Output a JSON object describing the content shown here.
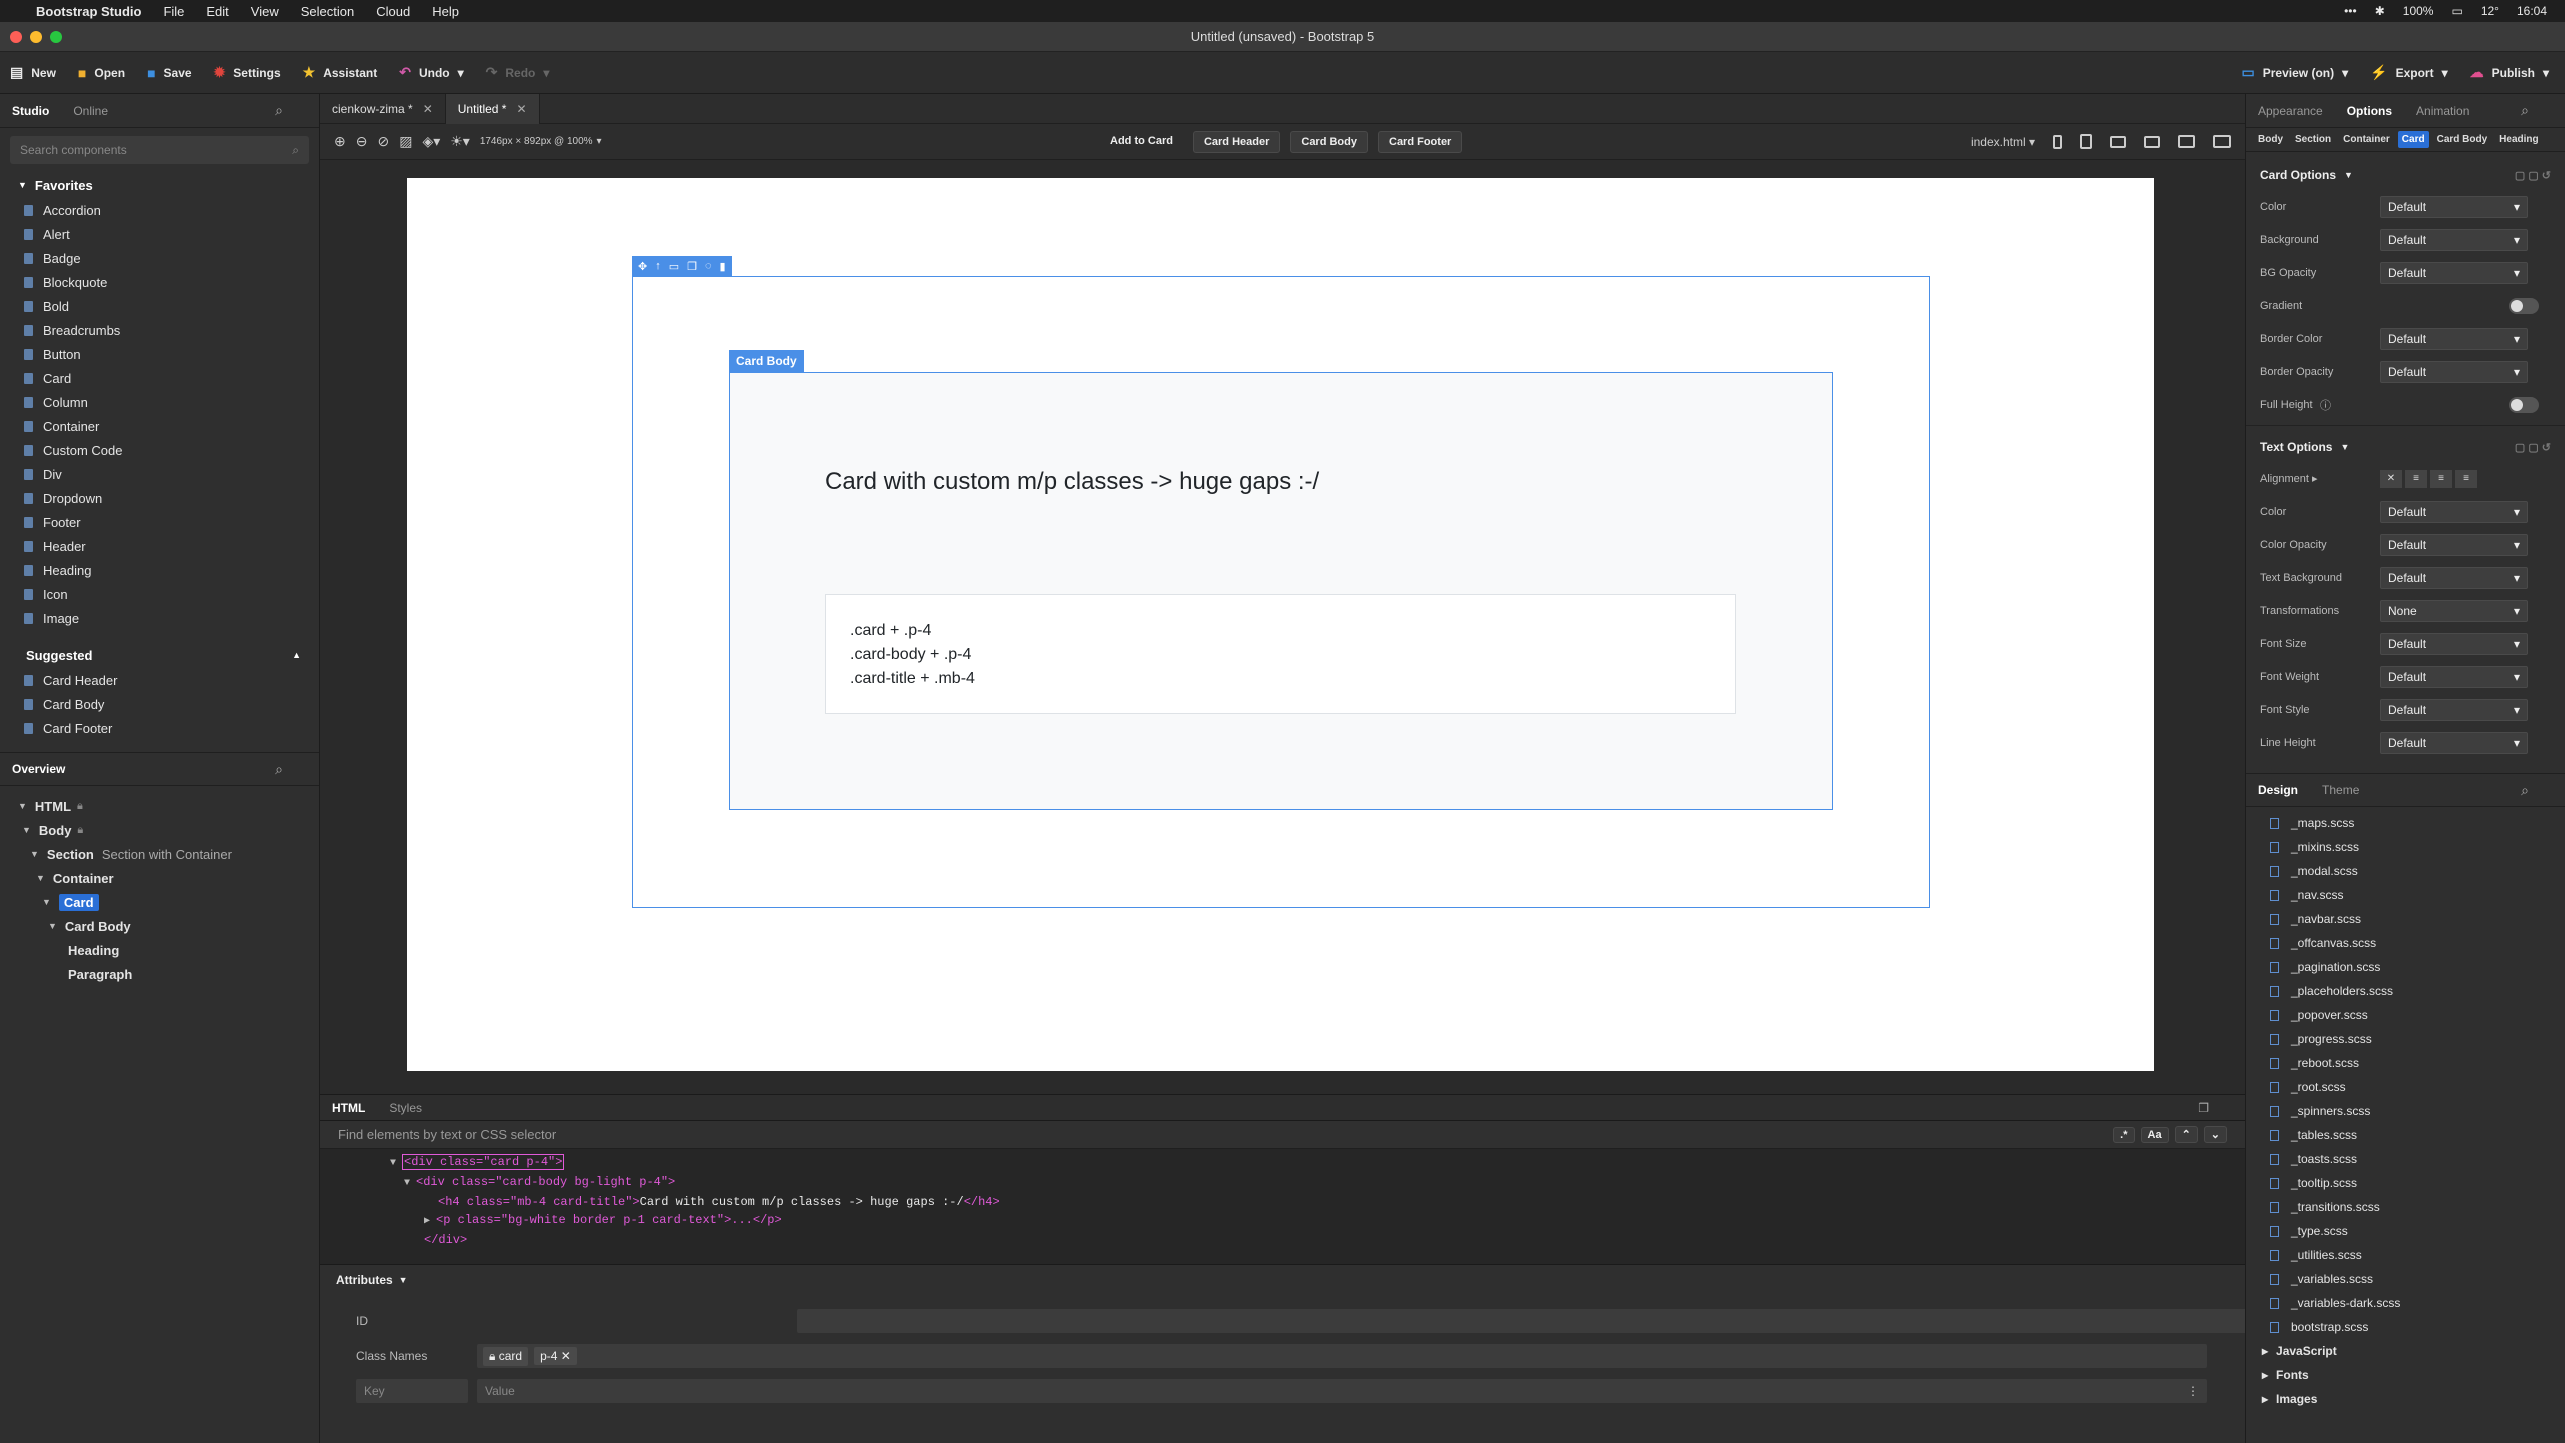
{
  "menubar": {
    "app": "Bootstrap Studio",
    "menus": [
      "File",
      "Edit",
      "View",
      "Selection",
      "Cloud",
      "Help"
    ],
    "status": [
      "•••",
      "100%",
      "12°",
      "16:04"
    ]
  },
  "window": {
    "title": "Untitled (unsaved) - Bootstrap 5"
  },
  "toolbar": {
    "new": "New",
    "open": "Open",
    "save": "Save",
    "settings": "Settings",
    "assistant": "Assistant",
    "undo": "Undo",
    "redo": "Redo",
    "preview": "Preview (on)",
    "export": "Export",
    "publish": "Publish"
  },
  "left": {
    "tabs": [
      "Studio",
      "Online"
    ],
    "search_placeholder": "Search components",
    "favorites_title": "Favorites",
    "favorites": [
      "Accordion",
      "Alert",
      "Badge",
      "Blockquote",
      "Bold",
      "Breadcrumbs",
      "Button",
      "Card",
      "Column",
      "Container",
      "Custom Code",
      "Div",
      "Dropdown",
      "Footer",
      "Header",
      "Heading",
      "Icon",
      "Image"
    ],
    "suggested_title": "Suggested",
    "suggested": [
      "Card Header",
      "Card Body",
      "Card Footer"
    ],
    "overview_tab": "Overview",
    "tree": {
      "html": "HTML",
      "body": "Body",
      "section": "Section",
      "section_sub": "Section with Container",
      "container": "Container",
      "card": "Card",
      "card_body": "Card Body",
      "heading": "Heading",
      "paragraph": "Paragraph"
    }
  },
  "filetabs": [
    {
      "label": "cienkow-zima *"
    },
    {
      "label": "Untitled *"
    }
  ],
  "canvas_toolbar": {
    "size": "1746px × 892px @ 100%",
    "add": "Add to Card",
    "header": "Card Header",
    "body": "Card Body",
    "footer": "Card Footer",
    "page": "index.html"
  },
  "canvas": {
    "body_label": "Card Body",
    "title": "Card with custom m/p classes -> huge gaps :-/",
    "lines": [
      ".card + .p-4",
      ".card-body + .p-4",
      ".card-title + .mb-4"
    ]
  },
  "htmlpanel": {
    "tabs": [
      "HTML",
      "Styles"
    ],
    "find_placeholder": "Find elements by text or CSS selector",
    "case_btn": "Aa",
    "code": {
      "l1": "<div class=\"card p-4\">",
      "l2": "<div class=\"card-body bg-light p-4\">",
      "l3_open": "<h4 class=\"mb-4 card-title\">",
      "l3_text": "Card with custom m/p classes -> huge gaps :-/",
      "l3_close": "</h4>",
      "l4": "<p class=\"bg-white border p-1 card-text\">...</p>",
      "l5": "</div>"
    }
  },
  "attributes": {
    "title": "Attributes",
    "id_label": "ID",
    "class_label": "Class Names",
    "classes": [
      "card",
      "p-4"
    ],
    "key_placeholder": "Key",
    "value_placeholder": "Value"
  },
  "right": {
    "tabs": [
      "Appearance",
      "Options",
      "Animation"
    ],
    "subtabs": [
      "Body",
      "Section",
      "Container",
      "Card",
      "Card Body",
      "Heading"
    ],
    "card_options": "Card Options",
    "card_rows": [
      {
        "label": "Color",
        "value": "Default"
      },
      {
        "label": "Background",
        "value": "Default"
      },
      {
        "label": "BG Opacity",
        "value": "Default"
      },
      {
        "label": "Gradient",
        "toggle": true
      },
      {
        "label": "Border Color",
        "value": "Default"
      },
      {
        "label": "Border Opacity",
        "value": "Default"
      },
      {
        "label": "Full Height",
        "toggle": true
      }
    ],
    "text_options": "Text Options",
    "alignment_label": "Alignment",
    "text_rows": [
      {
        "label": "Color",
        "value": "Default"
      },
      {
        "label": "Color Opacity",
        "value": "Default"
      },
      {
        "label": "Text Background",
        "value": "Default"
      },
      {
        "label": "Transformations",
        "value": "None"
      },
      {
        "label": "Font Size",
        "value": "Default"
      },
      {
        "label": "Font Weight",
        "value": "Default"
      },
      {
        "label": "Font Style",
        "value": "Default"
      },
      {
        "label": "Line Height",
        "value": "Default"
      }
    ],
    "design_tabs": [
      "Design",
      "Theme"
    ],
    "files": [
      "_maps.scss",
      "_mixins.scss",
      "_modal.scss",
      "_nav.scss",
      "_navbar.scss",
      "_offcanvas.scss",
      "_pagination.scss",
      "_placeholders.scss",
      "_popover.scss",
      "_progress.scss",
      "_reboot.scss",
      "_root.scss",
      "_spinners.scss",
      "_tables.scss",
      "_toasts.scss",
      "_tooltip.scss",
      "_transitions.scss",
      "_type.scss",
      "_utilities.scss",
      "_variables.scss",
      "_variables-dark.scss",
      "bootstrap.scss"
    ],
    "folders": [
      "JavaScript",
      "Fonts",
      "Images"
    ]
  },
  "colors": {
    "accent": "#4a8fe7",
    "select": "#2a6fd6",
    "tag": "#e05ad8"
  }
}
